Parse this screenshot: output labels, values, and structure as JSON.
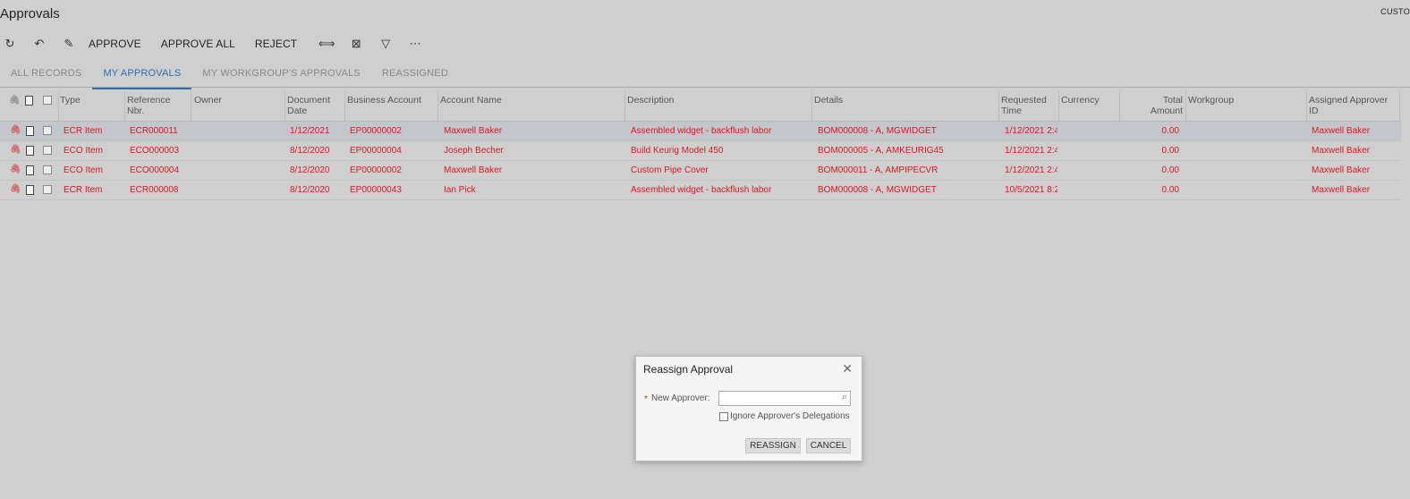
{
  "page": {
    "title": "Approvals",
    "customize": "CUSTO"
  },
  "toolbar": {
    "icons": [
      "refresh-icon",
      "undo-icon",
      "edit-icon"
    ],
    "buttons": {
      "approve": "APPROVE",
      "approve_all": "APPROVE ALL",
      "reject": "REJECT"
    },
    "right_icons": [
      "fit-columns-icon",
      "export-excel-icon",
      "filter-icon",
      "more-icon"
    ]
  },
  "tabs": [
    "ALL RECORDS",
    "MY APPROVALS",
    "MY WORKGROUP'S APPROVALS",
    "REASSIGNED"
  ],
  "active_tab": "MY APPROVALS",
  "grid": {
    "headers": {
      "type": "Type",
      "ref": "Reference Nbr.",
      "owner": "Owner",
      "docdate": "Document Date",
      "bacct": "Business Account",
      "acctname": "Account Name",
      "desc": "Description",
      "details": "Details",
      "reqtime": "Requested Time",
      "currency": "Currency",
      "total": "Total Amount",
      "workgroup": "Workgroup",
      "approver": "Assigned Approver ID"
    },
    "rows": [
      {
        "type": "ECR Item",
        "ref": "ECR000011",
        "owner": "",
        "docdate": "1/12/2021",
        "bacct": "EP00000002",
        "acctname": "Maxwell Baker",
        "desc": "Assembled widget - backflush labor",
        "details": "BOM000008 - A, MGWIDGET",
        "reqtime": "1/12/2021 2:4",
        "currency": "",
        "total": "0.00",
        "workgroup": "",
        "approver": "Maxwell Baker"
      },
      {
        "type": "ECO Item",
        "ref": "ECO000003",
        "owner": "",
        "docdate": "8/12/2020",
        "bacct": "EP00000004",
        "acctname": "Joseph Becher",
        "desc": "Build Keurig Model 450",
        "details": "BOM000005 - A, AMKEURIG45",
        "reqtime": "1/12/2021 2:4",
        "currency": "",
        "total": "0.00",
        "workgroup": "",
        "approver": "Maxwell Baker"
      },
      {
        "type": "ECO Item",
        "ref": "ECO000004",
        "owner": "",
        "docdate": "8/12/2020",
        "bacct": "EP00000002",
        "acctname": "Maxwell Baker",
        "desc": "Custom Pipe Cover",
        "details": "BOM000011 - A, AMPIPECVR",
        "reqtime": "1/12/2021 2:4",
        "currency": "",
        "total": "0.00",
        "workgroup": "",
        "approver": "Maxwell Baker"
      },
      {
        "type": "ECR Item",
        "ref": "ECR000008",
        "owner": "",
        "docdate": "8/12/2020",
        "bacct": "EP00000043",
        "acctname": "Ian Pick",
        "desc": "Assembled widget - backflush labor",
        "details": "BOM000008 - A, MGWIDGET",
        "reqtime": "10/5/2021 8:2",
        "currency": "",
        "total": "0.00",
        "workgroup": "",
        "approver": "Maxwell Baker"
      }
    ]
  },
  "dialog": {
    "title": "Reassign Approval",
    "required_mark": "*",
    "new_approver_label": "New Approver:",
    "new_approver_value": "",
    "ignore_label": "Ignore Approver's Delegations",
    "reassign_label": "REASSIGN",
    "cancel_label": "CANCEL"
  },
  "colors": {
    "accent": "#2a6fb0",
    "row_text": "#d6191f",
    "selected_row": "#c3c6ca"
  }
}
